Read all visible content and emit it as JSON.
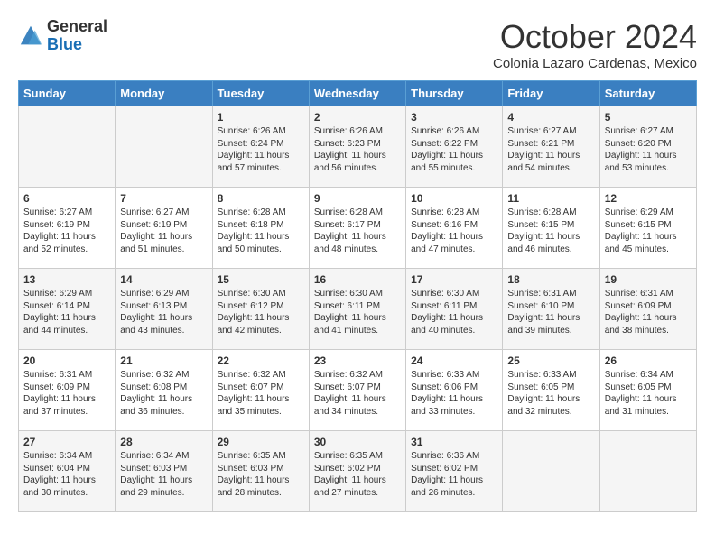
{
  "header": {
    "logo_general": "General",
    "logo_blue": "Blue",
    "month_title": "October 2024",
    "subtitle": "Colonia Lazaro Cardenas, Mexico"
  },
  "days_of_week": [
    "Sunday",
    "Monday",
    "Tuesday",
    "Wednesday",
    "Thursday",
    "Friday",
    "Saturday"
  ],
  "weeks": [
    [
      {
        "day": "",
        "info": ""
      },
      {
        "day": "",
        "info": ""
      },
      {
        "day": "1",
        "info": "Sunrise: 6:26 AM\nSunset: 6:24 PM\nDaylight: 11 hours and 57 minutes."
      },
      {
        "day": "2",
        "info": "Sunrise: 6:26 AM\nSunset: 6:23 PM\nDaylight: 11 hours and 56 minutes."
      },
      {
        "day": "3",
        "info": "Sunrise: 6:26 AM\nSunset: 6:22 PM\nDaylight: 11 hours and 55 minutes."
      },
      {
        "day": "4",
        "info": "Sunrise: 6:27 AM\nSunset: 6:21 PM\nDaylight: 11 hours and 54 minutes."
      },
      {
        "day": "5",
        "info": "Sunrise: 6:27 AM\nSunset: 6:20 PM\nDaylight: 11 hours and 53 minutes."
      }
    ],
    [
      {
        "day": "6",
        "info": "Sunrise: 6:27 AM\nSunset: 6:19 PM\nDaylight: 11 hours and 52 minutes."
      },
      {
        "day": "7",
        "info": "Sunrise: 6:27 AM\nSunset: 6:19 PM\nDaylight: 11 hours and 51 minutes."
      },
      {
        "day": "8",
        "info": "Sunrise: 6:28 AM\nSunset: 6:18 PM\nDaylight: 11 hours and 50 minutes."
      },
      {
        "day": "9",
        "info": "Sunrise: 6:28 AM\nSunset: 6:17 PM\nDaylight: 11 hours and 48 minutes."
      },
      {
        "day": "10",
        "info": "Sunrise: 6:28 AM\nSunset: 6:16 PM\nDaylight: 11 hours and 47 minutes."
      },
      {
        "day": "11",
        "info": "Sunrise: 6:28 AM\nSunset: 6:15 PM\nDaylight: 11 hours and 46 minutes."
      },
      {
        "day": "12",
        "info": "Sunrise: 6:29 AM\nSunset: 6:15 PM\nDaylight: 11 hours and 45 minutes."
      }
    ],
    [
      {
        "day": "13",
        "info": "Sunrise: 6:29 AM\nSunset: 6:14 PM\nDaylight: 11 hours and 44 minutes."
      },
      {
        "day": "14",
        "info": "Sunrise: 6:29 AM\nSunset: 6:13 PM\nDaylight: 11 hours and 43 minutes."
      },
      {
        "day": "15",
        "info": "Sunrise: 6:30 AM\nSunset: 6:12 PM\nDaylight: 11 hours and 42 minutes."
      },
      {
        "day": "16",
        "info": "Sunrise: 6:30 AM\nSunset: 6:11 PM\nDaylight: 11 hours and 41 minutes."
      },
      {
        "day": "17",
        "info": "Sunrise: 6:30 AM\nSunset: 6:11 PM\nDaylight: 11 hours and 40 minutes."
      },
      {
        "day": "18",
        "info": "Sunrise: 6:31 AM\nSunset: 6:10 PM\nDaylight: 11 hours and 39 minutes."
      },
      {
        "day": "19",
        "info": "Sunrise: 6:31 AM\nSunset: 6:09 PM\nDaylight: 11 hours and 38 minutes."
      }
    ],
    [
      {
        "day": "20",
        "info": "Sunrise: 6:31 AM\nSunset: 6:09 PM\nDaylight: 11 hours and 37 minutes."
      },
      {
        "day": "21",
        "info": "Sunrise: 6:32 AM\nSunset: 6:08 PM\nDaylight: 11 hours and 36 minutes."
      },
      {
        "day": "22",
        "info": "Sunrise: 6:32 AM\nSunset: 6:07 PM\nDaylight: 11 hours and 35 minutes."
      },
      {
        "day": "23",
        "info": "Sunrise: 6:32 AM\nSunset: 6:07 PM\nDaylight: 11 hours and 34 minutes."
      },
      {
        "day": "24",
        "info": "Sunrise: 6:33 AM\nSunset: 6:06 PM\nDaylight: 11 hours and 33 minutes."
      },
      {
        "day": "25",
        "info": "Sunrise: 6:33 AM\nSunset: 6:05 PM\nDaylight: 11 hours and 32 minutes."
      },
      {
        "day": "26",
        "info": "Sunrise: 6:34 AM\nSunset: 6:05 PM\nDaylight: 11 hours and 31 minutes."
      }
    ],
    [
      {
        "day": "27",
        "info": "Sunrise: 6:34 AM\nSunset: 6:04 PM\nDaylight: 11 hours and 30 minutes."
      },
      {
        "day": "28",
        "info": "Sunrise: 6:34 AM\nSunset: 6:03 PM\nDaylight: 11 hours and 29 minutes."
      },
      {
        "day": "29",
        "info": "Sunrise: 6:35 AM\nSunset: 6:03 PM\nDaylight: 11 hours and 28 minutes."
      },
      {
        "day": "30",
        "info": "Sunrise: 6:35 AM\nSunset: 6:02 PM\nDaylight: 11 hours and 27 minutes."
      },
      {
        "day": "31",
        "info": "Sunrise: 6:36 AM\nSunset: 6:02 PM\nDaylight: 11 hours and 26 minutes."
      },
      {
        "day": "",
        "info": ""
      },
      {
        "day": "",
        "info": ""
      }
    ]
  ]
}
